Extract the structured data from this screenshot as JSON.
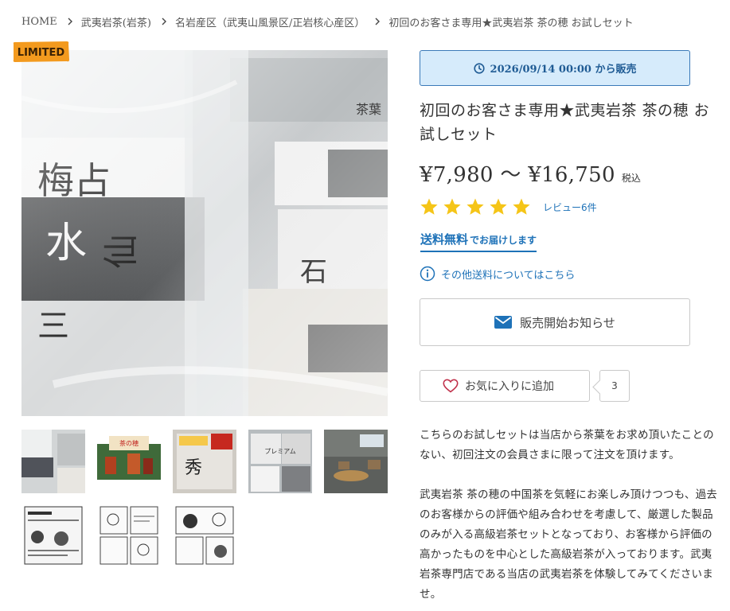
{
  "breadcrumb": [
    {
      "label": "HOME"
    },
    {
      "label": "武夷岩茶(岩茶)"
    },
    {
      "label": "名岩産区（武夷山風景区/正岩核心産区）"
    },
    {
      "label": "初回のお客さま専用★武夷岩茶 茶の穂 お試しセット"
    }
  ],
  "badge": {
    "label": "LIMITED",
    "color": "#f39a1e"
  },
  "release": {
    "label": "2026/09/14 00:00 から販売",
    "icon": "clock-icon"
  },
  "product": {
    "title": "初回のお客さま専用★武夷岩茶 茶の穂 お試しセット",
    "price_range": "¥7,980 〜 ¥16,750",
    "tax_label": "税込",
    "rating": 5,
    "review_link": "レビュー6件"
  },
  "shipping": {
    "free_label": "送料無料",
    "deliver_label": "でお届けします"
  },
  "other_shipping": {
    "label": "その他送料についてはこちら"
  },
  "notify_button": {
    "label": "販売開始お知らせ"
  },
  "favorite": {
    "label": "お気に入りに追加",
    "count": "3"
  },
  "description": [
    "こちらのお試しセットは当店から茶葉をお求め頂いたことのない、初回注文の会員さまに限って注文を頂けます。",
    "武夷岩茶 茶の穂の中国茶を気軽にお楽しみ頂けつつも、過去のお客様からの評価や組み合わせを考慮して、厳選した製品のみが入る高級岩茶セットとなっており、お客様から評価の高かったものを中心とした高級岩茶が入っております。武夷岩茶専門店である当店の武夷岩茶を体験してみてくださいませ。"
  ],
  "colors": {
    "accent": "#1e72b8",
    "star": "#f5c518",
    "release_bg": "#d6ebfb"
  }
}
